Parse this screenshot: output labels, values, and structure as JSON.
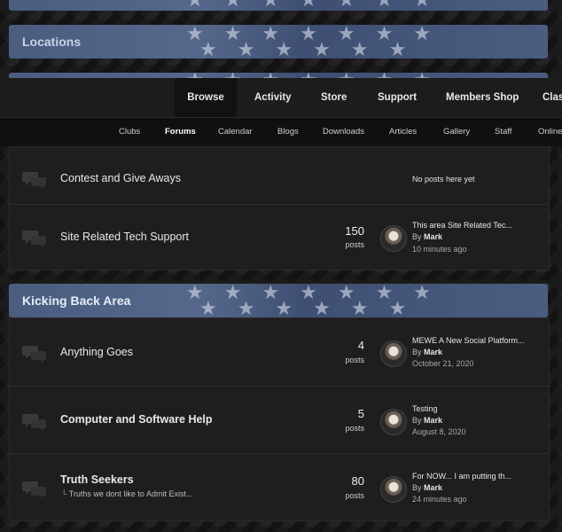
{
  "categories": {
    "locations": "Locations",
    "kicking_back": "Kicking Back Area"
  },
  "nav": {
    "tabs": [
      "Browse",
      "Activity",
      "Store",
      "Support",
      "Members Shop",
      "Clas"
    ],
    "sub": [
      "Clubs",
      "Forums",
      "Calendar",
      "Blogs",
      "Downloads",
      "Articles",
      "Gallery",
      "Staff",
      "Online"
    ]
  },
  "forums_top": [
    {
      "name": "Contest and Give Aways",
      "no_posts": "No posts here yet"
    },
    {
      "name": "Site Related Tech Support",
      "count": "150",
      "posts_label": "posts",
      "last_title": "This area Site Related Tec...",
      "by_prefix": "By",
      "by_user": "Mark",
      "time": "10 minutes ago"
    }
  ],
  "forums_kicking": [
    {
      "name": "Anything Goes",
      "count": "4",
      "posts_label": "posts",
      "last_title": "MEWE A New Social Platform...",
      "by_prefix": "By",
      "by_user": "Mark",
      "time": "October 21, 2020"
    },
    {
      "name": "Computer and Software Help",
      "count": "5",
      "posts_label": "posts",
      "last_title": "Testing",
      "by_prefix": "By",
      "by_user": "Mark",
      "time": "August 8, 2020"
    },
    {
      "name": "Truth Seekers",
      "subforum": "Truths we dont like to Admit Exist...",
      "count": "80",
      "posts_label": "posts",
      "last_title": "For NOW... I am putting th...",
      "by_prefix": "By",
      "by_user": "Mark",
      "time": "24 minutes ago"
    }
  ],
  "icons": {
    "forum": "chat-bubbles-icon",
    "subforum": "subforum-arrow-icon",
    "avatar": "user-avatar"
  },
  "colors": {
    "header_blue": "#4a5d80",
    "nav_active_bg": "#121212",
    "panel_bg": "#1e1e1e"
  }
}
